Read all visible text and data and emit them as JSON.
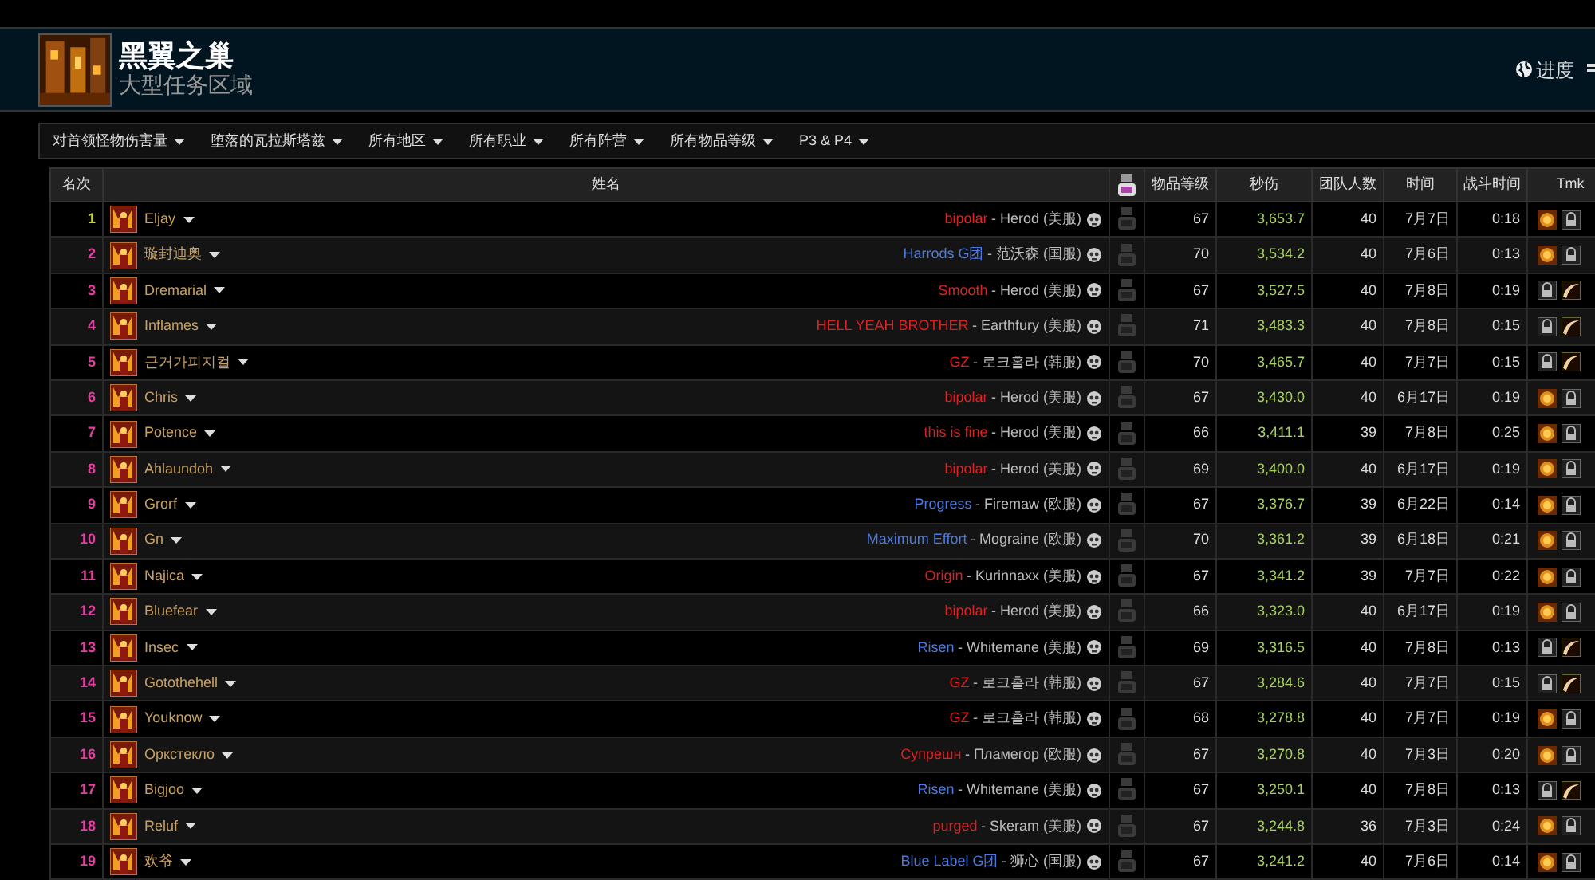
{
  "header": {
    "title": "黑翼之巢",
    "subtitle": "大型任务区域",
    "progress_link": "进度"
  },
  "filters": [
    {
      "label": "对首领怪物伤害量"
    },
    {
      "label": "堕落的瓦拉斯塔兹"
    },
    {
      "label": "所有地区"
    },
    {
      "label": "所有职业"
    },
    {
      "label": "所有阵营"
    },
    {
      "label": "所有物品等级"
    },
    {
      "label": "P3 & P4"
    }
  ],
  "table": {
    "columns": [
      "名次",
      "姓名",
      "物品等级",
      "秒伤",
      "团队人数",
      "时间",
      "战斗时间",
      "Tmk"
    ],
    "rows": [
      {
        "rank": {
          "text": "1",
          "color": "#c8d040"
        },
        "name": "Eljay",
        "guild": {
          "name": "bipolar",
          "color": "#e02020"
        },
        "realm": "- Herod (美服)",
        "ilvl": "67",
        "dps": "3,653.7",
        "raid": "40",
        "date": "7月7日",
        "duration": "0:18",
        "tmk": [
          {
            "kind": "coin"
          },
          {
            "kind": "lock"
          }
        ]
      },
      {
        "rank": {
          "text": "2",
          "color": "#e040a0"
        },
        "name": "璇封迪奥",
        "guild": {
          "name": "Harrods G团",
          "color": "#4a7ae0"
        },
        "realm": "- 范沃森 (国服)",
        "ilvl": "70",
        "dps": "3,534.2",
        "raid": "40",
        "date": "7月6日",
        "duration": "0:13",
        "tmk": [
          {
            "kind": "coin"
          },
          {
            "kind": "lock"
          }
        ]
      },
      {
        "rank": {
          "text": "3",
          "color": "#e040a0"
        },
        "name": "Dremarial",
        "guild": {
          "name": "Smooth",
          "color": "#e02020"
        },
        "realm": "- Herod (美服)",
        "ilvl": "67",
        "dps": "3,527.5",
        "raid": "40",
        "date": "7月8日",
        "duration": "0:19",
        "tmk": [
          {
            "kind": "lock"
          },
          {
            "kind": "horn"
          }
        ]
      },
      {
        "rank": {
          "text": "4",
          "color": "#e040a0"
        },
        "name": "Inflames",
        "guild": {
          "name": "HELL YEAH BROTHER",
          "color": "#e02020"
        },
        "realm": "- Earthfury (美服)",
        "ilvl": "71",
        "dps": "3,483.3",
        "raid": "40",
        "date": "7月8日",
        "duration": "0:15",
        "tmk": [
          {
            "kind": "lock"
          },
          {
            "kind": "horn"
          }
        ]
      },
      {
        "rank": {
          "text": "5",
          "color": "#e040a0"
        },
        "name": "근거가피지컬",
        "guild": {
          "name": "GZ",
          "color": "#e02020"
        },
        "realm": "- 로크홀라 (韩服)",
        "ilvl": "70",
        "dps": "3,465.7",
        "raid": "40",
        "date": "7月7日",
        "duration": "0:15",
        "tmk": [
          {
            "kind": "lock"
          },
          {
            "kind": "horn"
          }
        ]
      },
      {
        "rank": {
          "text": "6",
          "color": "#e040a0"
        },
        "name": "Chris",
        "guild": {
          "name": "bipolar",
          "color": "#e02020"
        },
        "realm": "- Herod (美服)",
        "ilvl": "67",
        "dps": "3,430.0",
        "raid": "40",
        "date": "6月17日",
        "duration": "0:19",
        "tmk": [
          {
            "kind": "coin"
          },
          {
            "kind": "lock"
          }
        ]
      },
      {
        "rank": {
          "text": "7",
          "color": "#e040a0"
        },
        "name": "Potence",
        "guild": {
          "name": "this is fine",
          "color": "#e02020"
        },
        "realm": "- Herod (美服)",
        "ilvl": "66",
        "dps": "3,411.1",
        "raid": "39",
        "date": "7月8日",
        "duration": "0:25",
        "tmk": [
          {
            "kind": "coin"
          },
          {
            "kind": "lock"
          }
        ]
      },
      {
        "rank": {
          "text": "8",
          "color": "#e040a0"
        },
        "name": "Ahlaundoh",
        "guild": {
          "name": "bipolar",
          "color": "#e02020"
        },
        "realm": "- Herod (美服)",
        "ilvl": "69",
        "dps": "3,400.0",
        "raid": "40",
        "date": "6月17日",
        "duration": "0:19",
        "tmk": [
          {
            "kind": "coin"
          },
          {
            "kind": "lock"
          }
        ]
      },
      {
        "rank": {
          "text": "9",
          "color": "#e040a0"
        },
        "name": "Grorf",
        "guild": {
          "name": "Progress",
          "color": "#4a7ae0"
        },
        "realm": "- Firemaw (欧服)",
        "ilvl": "67",
        "dps": "3,376.7",
        "raid": "39",
        "date": "6月22日",
        "duration": "0:14",
        "tmk": [
          {
            "kind": "coin"
          },
          {
            "kind": "lock"
          }
        ]
      },
      {
        "rank": {
          "text": "10",
          "color": "#e040a0"
        },
        "name": "Gn",
        "guild": {
          "name": "Maximum Effort",
          "color": "#4a7ae0"
        },
        "realm": "- Mograine (欧服)",
        "ilvl": "70",
        "dps": "3,361.2",
        "raid": "39",
        "date": "6月18日",
        "duration": "0:21",
        "tmk": [
          {
            "kind": "coin"
          },
          {
            "kind": "lock"
          }
        ]
      },
      {
        "rank": {
          "text": "11",
          "color": "#e040a0"
        },
        "name": "Najica",
        "guild": {
          "name": "Origin",
          "color": "#e02020"
        },
        "realm": "- Kurinnaxx (美服)",
        "ilvl": "67",
        "dps": "3,341.2",
        "raid": "39",
        "date": "7月7日",
        "duration": "0:22",
        "tmk": [
          {
            "kind": "coin"
          },
          {
            "kind": "lock"
          }
        ]
      },
      {
        "rank": {
          "text": "12",
          "color": "#e040a0"
        },
        "name": "Bluefear",
        "guild": {
          "name": "bipolar",
          "color": "#e02020"
        },
        "realm": "- Herod (美服)",
        "ilvl": "66",
        "dps": "3,323.0",
        "raid": "40",
        "date": "6月17日",
        "duration": "0:19",
        "tmk": [
          {
            "kind": "coin"
          },
          {
            "kind": "lock"
          }
        ]
      },
      {
        "rank": {
          "text": "13",
          "color": "#e040a0"
        },
        "name": "Insec",
        "guild": {
          "name": "Risen",
          "color": "#4a7ae0"
        },
        "realm": "- Whitemane (美服)",
        "ilvl": "69",
        "dps": "3,316.5",
        "raid": "40",
        "date": "7月8日",
        "duration": "0:13",
        "tmk": [
          {
            "kind": "lock"
          },
          {
            "kind": "horn"
          }
        ]
      },
      {
        "rank": {
          "text": "14",
          "color": "#e040a0"
        },
        "name": "Gotothehell",
        "guild": {
          "name": "GZ",
          "color": "#e02020"
        },
        "realm": "- 로크홀라 (韩服)",
        "ilvl": "67",
        "dps": "3,284.6",
        "raid": "40",
        "date": "7月7日",
        "duration": "0:15",
        "tmk": [
          {
            "kind": "lock"
          },
          {
            "kind": "horn"
          }
        ]
      },
      {
        "rank": {
          "text": "15",
          "color": "#e040a0"
        },
        "name": "Youknow",
        "guild": {
          "name": "GZ",
          "color": "#e02020"
        },
        "realm": "- 로크홀라 (韩服)",
        "ilvl": "68",
        "dps": "3,278.8",
        "raid": "40",
        "date": "7月7日",
        "duration": "0:19",
        "tmk": [
          {
            "kind": "coin"
          },
          {
            "kind": "lock"
          }
        ]
      },
      {
        "rank": {
          "text": "16",
          "color": "#e040a0"
        },
        "name": "Оркстекло",
        "guild": {
          "name": "Супрешн",
          "color": "#e02020"
        },
        "realm": "- Пламегор (欧服)",
        "ilvl": "67",
        "dps": "3,270.8",
        "raid": "40",
        "date": "7月3日",
        "duration": "0:20",
        "tmk": [
          {
            "kind": "coin"
          },
          {
            "kind": "lock"
          }
        ]
      },
      {
        "rank": {
          "text": "17",
          "color": "#e040a0"
        },
        "name": "Bigjoo",
        "guild": {
          "name": "Risen",
          "color": "#4a7ae0"
        },
        "realm": "- Whitemane (美服)",
        "ilvl": "67",
        "dps": "3,250.1",
        "raid": "40",
        "date": "7月8日",
        "duration": "0:13",
        "tmk": [
          {
            "kind": "lock"
          },
          {
            "kind": "horn"
          }
        ]
      },
      {
        "rank": {
          "text": "18",
          "color": "#e040a0"
        },
        "name": "Reluf",
        "guild": {
          "name": "purged",
          "color": "#e02020"
        },
        "realm": "- Skeram (美服)",
        "ilvl": "67",
        "dps": "3,244.8",
        "raid": "36",
        "date": "7月3日",
        "duration": "0:24",
        "tmk": [
          {
            "kind": "coin"
          },
          {
            "kind": "lock"
          }
        ]
      },
      {
        "rank": {
          "text": "19",
          "color": "#e040a0"
        },
        "name": "欢爷",
        "guild": {
          "name": "Blue Label G团",
          "color": "#4a7ae0"
        },
        "realm": "- 狮心 (国服)",
        "ilvl": "67",
        "dps": "3,241.2",
        "raid": "40",
        "date": "7月6日",
        "duration": "0:14",
        "tmk": [
          {
            "kind": "coin"
          },
          {
            "kind": "lock"
          }
        ]
      }
    ]
  }
}
